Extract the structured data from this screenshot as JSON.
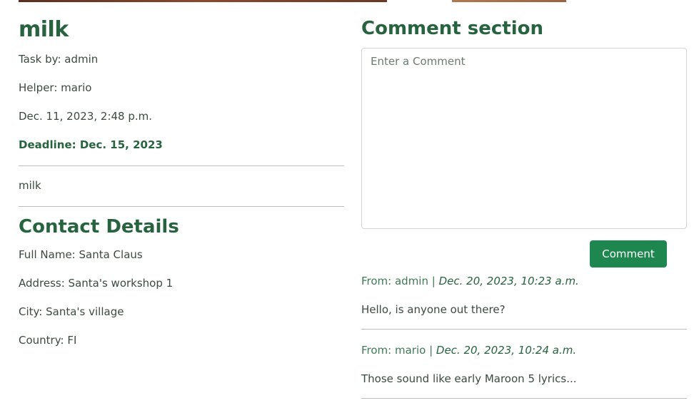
{
  "task": {
    "title": "milk",
    "task_by": "Task by: admin",
    "helper": "Helper: mario",
    "created": "Dec. 11, 2023, 2:48 p.m.",
    "deadline": "Deadline: Dec. 15, 2023",
    "description": "milk"
  },
  "contact": {
    "heading": "Contact Details",
    "full_name": "Full Name: Santa Claus",
    "address": "Address: Santa's workshop 1",
    "city": "City: Santa's village",
    "country": "Country: FI"
  },
  "comments_section": {
    "heading": "Comment section",
    "placeholder": "Enter a Comment",
    "submit_label": "Comment",
    "comments": [
      {
        "from": "From: admin |",
        "date": "Dec. 20, 2023, 10:23 a.m.",
        "text": "Hello, is anyone out there?"
      },
      {
        "from": "From: mario |",
        "date": "Dec. 20, 2023, 10:24 a.m.",
        "text": "Those sound like early Maroon 5 lyrics..."
      }
    ]
  },
  "colors": {
    "heading_green": "#27633f",
    "button_green": "#1e8750",
    "text": "#3b4a3f",
    "rule": "#bdbdbd"
  }
}
